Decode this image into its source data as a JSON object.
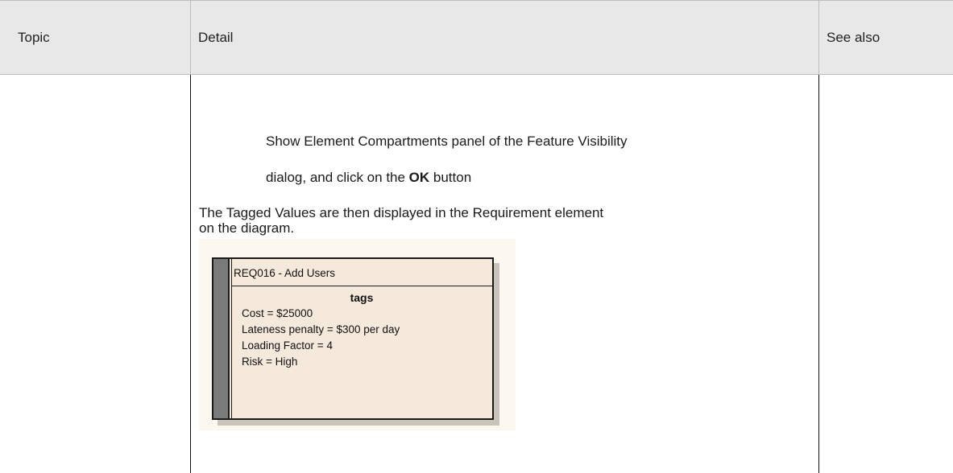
{
  "table": {
    "headers": {
      "topic": "Topic",
      "detail": "Detail",
      "see_also": "See also"
    },
    "detail": {
      "line1": "Show Element Compartments panel of the Feature Visibility",
      "line2_prefix": "dialog, and click on the ",
      "line2_bold": "OK",
      "line2_suffix": " button",
      "para_line1": "The Tagged Values are then displayed in the Requirement element",
      "para_line2": "on the diagram."
    }
  },
  "requirement_element": {
    "title": "REQ016 - Add Users",
    "compartment_title": "tags",
    "tags": [
      "Cost = $25000",
      "Lateness penalty = $300 per day",
      "Loading Factor = 4",
      "Risk = High"
    ],
    "colors": {
      "fill": "#f5e9dc",
      "bar": "#7a7a7a",
      "background": "#fdf8ef"
    }
  }
}
